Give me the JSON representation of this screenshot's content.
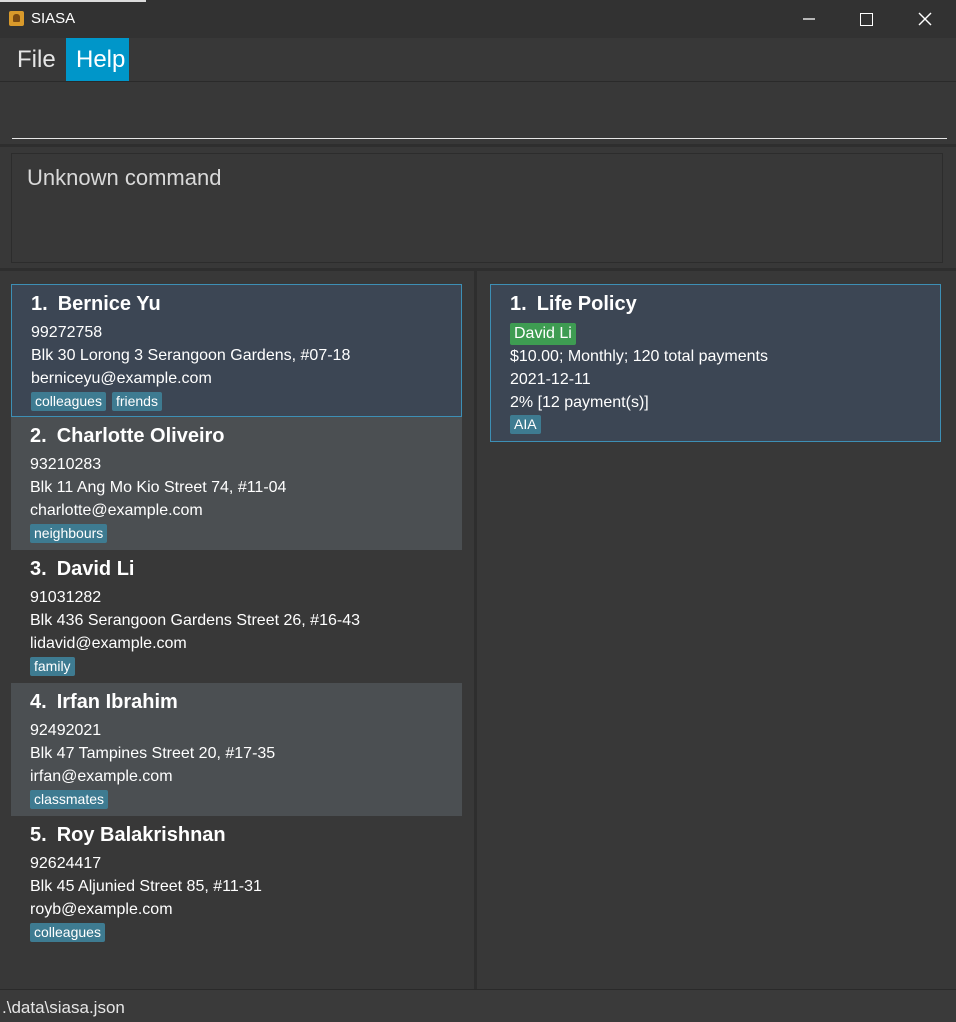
{
  "window": {
    "title": "SIASA",
    "minimize": "—",
    "close": "✕"
  },
  "menu": {
    "file": "File",
    "help": "Help"
  },
  "command": {
    "value": "",
    "placeholder": ""
  },
  "result": {
    "message": "Unknown command"
  },
  "people": [
    {
      "index": "1.",
      "name": "Bernice Yu",
      "phone": "99272758",
      "address": "Blk 30 Lorong 3 Serangoon Gardens, #07-18",
      "email": "berniceyu@example.com",
      "tags": [
        "colleagues",
        "friends"
      ]
    },
    {
      "index": "2.",
      "name": "Charlotte Oliveiro",
      "phone": "93210283",
      "address": "Blk 11 Ang Mo Kio Street 74, #11-04",
      "email": "charlotte@example.com",
      "tags": [
        "neighbours"
      ]
    },
    {
      "index": "3.",
      "name": "David Li",
      "phone": "91031282",
      "address": "Blk 436 Serangoon Gardens Street 26, #16-43",
      "email": "lidavid@example.com",
      "tags": [
        "family"
      ]
    },
    {
      "index": "4.",
      "name": "Irfan Ibrahim",
      "phone": "92492021",
      "address": "Blk 47 Tampines Street 20, #17-35",
      "email": "irfan@example.com",
      "tags": [
        "classmates"
      ]
    },
    {
      "index": "5.",
      "name": "Roy Balakrishnan",
      "phone": "92624417",
      "address": "Blk 45 Aljunied Street 85, #11-31",
      "email": "royb@example.com",
      "tags": [
        "colleagues"
      ]
    }
  ],
  "policies": [
    {
      "index": "1.",
      "title": "Life Policy",
      "owner": "David Li",
      "payment": "$10.00; Monthly; 120 total payments",
      "expiry": "2021-12-11",
      "commission": "2% [12 payment(s)]",
      "company": "AIA"
    }
  ],
  "status": {
    "path": ".\\data\\siasa.json"
  },
  "colors": {
    "accent": "#0096c9",
    "tag": "#3e7b91",
    "owner_tag": "#3e9c52",
    "selected_border": "#3d8fb5",
    "background": "#383838"
  },
  "icons": {
    "app": "app-icon",
    "minimize": "minimize-icon",
    "maximize": "maximize-icon",
    "close": "close-icon"
  }
}
